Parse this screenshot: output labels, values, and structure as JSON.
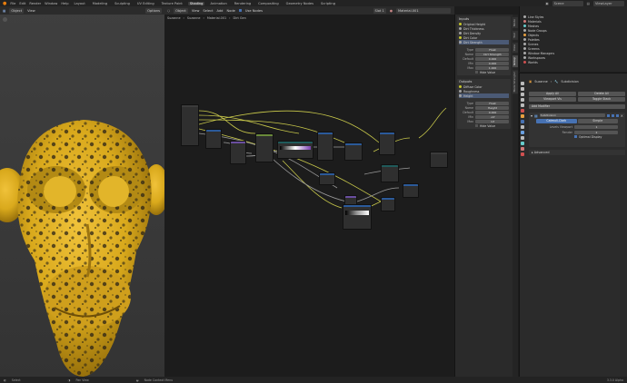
{
  "menu": {
    "app_icon": "blender-logo-icon",
    "items": [
      "File",
      "Edit",
      "Render",
      "Window",
      "Help"
    ],
    "workspaces": [
      "Layout",
      "Modeling",
      "Sculpting",
      "UV Editing",
      "Texture Paint",
      "Shading",
      "Animation",
      "Rendering",
      "Compositing",
      "Geometry Nodes",
      "Scripting"
    ],
    "active_workspace": "Shading",
    "scene_label": "Scene",
    "viewlayer_label": "ViewLayer"
  },
  "viewport": {
    "mode": "Object",
    "menus": [
      "View"
    ],
    "options_label": "Options",
    "overlay_text": "User Perspective"
  },
  "node_editor": {
    "editor_type": "Object",
    "menus": [
      "View",
      "Select",
      "Add",
      "Node"
    ],
    "use_nodes_label": "Use Nodes",
    "slot": "Slot 1",
    "material": "Material.001",
    "breadcrumb": [
      "Suzanne",
      "Suzanne",
      "Material.001",
      "Dirt Gen"
    ]
  },
  "n_panel": {
    "tabs": [
      "Node",
      "Tool",
      "View",
      "Group",
      "Node Wrangler"
    ],
    "active_tab": "Group",
    "inputs_title": "Inputs",
    "inputs": [
      "Original Height",
      "Dirt Thickness",
      "Dirt Density",
      "Dirt Color",
      "Dirt Strength"
    ],
    "selected_input": "Dirt Strength",
    "input_props": {
      "type_label": "Type",
      "type_value": "Float",
      "name_label": "Name",
      "name_value": "Dirt Strength",
      "default_label": "Default",
      "default_value": "0.000",
      "min_label": "Min",
      "min_value": "0.000",
      "max_label": "Max",
      "max_value": "1.000",
      "hide_value_label": "Hide Value"
    },
    "outputs_title": "Outputs",
    "outputs": [
      "Diffuse Color",
      "Roughness",
      "Height"
    ],
    "selected_output": "Height",
    "output_props": {
      "type_label": "Type",
      "type_value": "Float",
      "name_label": "Name",
      "name_value": "Height",
      "default_label": "Default",
      "default_value": "0.000",
      "min_label": "Min",
      "min_value": "-inf",
      "max_label": "Max",
      "max_value": "inf",
      "hide_value_label": "Hide Value"
    }
  },
  "outliner": {
    "items": [
      "Line Styles",
      "Materials",
      "Meshes",
      "Node Groups",
      "Objects",
      "Palettes",
      "Scenes",
      "Screens",
      "Window Managers",
      "Workspaces",
      "Worlds"
    ]
  },
  "properties": {
    "breadcrumb": [
      "Suzanne",
      "Subdivision"
    ],
    "apply_all": "Apply All",
    "delete_all": "Delete All",
    "viewport_vis": "Viewport Vis",
    "toggle_stack": "Toggle Stack",
    "add_modifier": "Add Modifier",
    "modifier_name": "Subdivision",
    "catmull_clark": "Catmull-Clark",
    "simple": "Simple",
    "levels_viewport_label": "Levels Viewport",
    "levels_viewport_value": "1",
    "render_label": "Render",
    "render_value": "2",
    "optimal_display": "Optimal Display",
    "advanced": "Advanced"
  },
  "status_bar": {
    "items": [
      "Select",
      "Pan View",
      "Node Context Menu"
    ],
    "version": "3.3.0 Alpha"
  },
  "colors": {
    "accent_blue": "#4772b3",
    "suzanne_yellow": "#d9a91c",
    "dirt_dark": "#2a2316",
    "link_yellow": "#c8c84a",
    "link_grey": "#9a9a9a",
    "socket_yellow": "#c7c729",
    "socket_grey": "#a1a1a1",
    "socket_purple": "#6363c7"
  }
}
